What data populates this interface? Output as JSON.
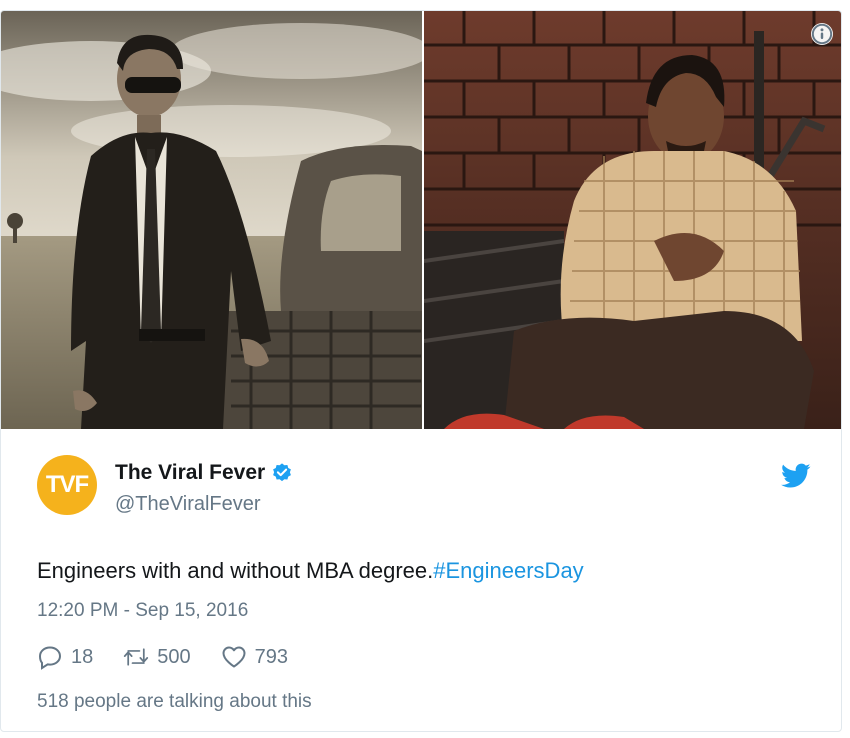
{
  "tweet": {
    "display_name": "The Viral Fever",
    "handle": "@TheViralFever",
    "avatar_text": "TVF",
    "text": "Engineers with and without MBA degree.",
    "hashtag": "#EngineersDay",
    "timestamp": "12:20 PM - Sep 15, 2016",
    "replies": "18",
    "retweets": "500",
    "likes": "793",
    "talking": "518 people are talking about this"
  },
  "media": {
    "left_photo": "man-in-suit-sepia-photo",
    "right_photo": "man-crouching-by-brick-wall-photo"
  },
  "icons": {
    "verified": "verified-badge-icon",
    "brand": "twitter-bird-icon",
    "info": "info-icon",
    "reply": "reply-icon",
    "retweet": "retweet-icon",
    "like": "heart-icon"
  },
  "colors": {
    "accent": "#1da1f2",
    "hashtag": "#1b95e0",
    "muted": "#657786",
    "avatar_bg": "#f5b21c",
    "text": "#14171a"
  }
}
